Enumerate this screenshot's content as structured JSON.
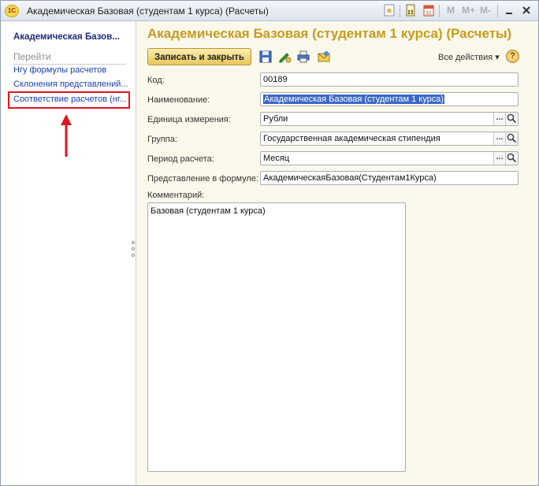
{
  "window": {
    "title": "Академическая Базовая (студентам 1 курса) (Расчеты)",
    "logo_text": "1С",
    "memory_buttons": [
      "M",
      "M+",
      "M-"
    ]
  },
  "nav": {
    "title": "Академическая Базов...",
    "group_label": "Перейти",
    "links": [
      "Нгу формулы расчетов",
      "Склонения представлений...",
      "Соответствие расчетов (нг..."
    ]
  },
  "form": {
    "title": "Академическая Базовая (студентам 1 курса) (Расчеты)",
    "save_close_label": "Записать и закрыть",
    "all_actions_label": "Все действия ▾",
    "help_label": "?",
    "fields": {
      "code_label": "Код:",
      "code_value": "00189",
      "name_label": "Наименование:",
      "name_value": "Академическая Базовая (студентам 1 курса)",
      "unit_label": "Единица измерения:",
      "unit_value": "Рубли",
      "group_label": "Группа:",
      "group_value": "Государственная академическая стипендия",
      "period_label": "Период расчета:",
      "period_value": "Месяц",
      "formula_label": "Представление в формуле:",
      "formula_value": "АкадемическаяБазовая(Студентам1Курса)",
      "comment_label": "Комментарий:",
      "comment_value": "Базовая (студентам 1 курса)"
    },
    "picker_dots": "..."
  },
  "colors": {
    "title_accent": "#c99a1d",
    "nav_link": "#1a3fb6",
    "highlight": "#e0151d"
  }
}
